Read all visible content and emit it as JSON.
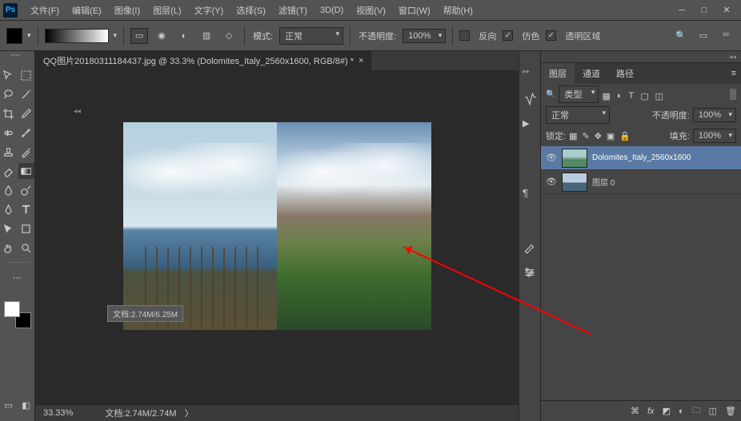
{
  "menu": [
    "文件(F)",
    "编辑(E)",
    "图像(I)",
    "图层(L)",
    "文字(Y)",
    "选择(S)",
    "滤镜(T)",
    "3D(D)",
    "视图(V)",
    "窗口(W)",
    "帮助(H)"
  ],
  "options": {
    "mode_label": "模式:",
    "mode_value": "正常",
    "opacity_label": "不透明度:",
    "opacity_value": "100%",
    "reverse": "反向",
    "dither": "仿色",
    "transparency": "透明区域"
  },
  "doc": {
    "tab_title": "QQ图片20180311184437.jpg @ 33.3% (Dolomites_Italy_2560x1600, RGB/8#) *",
    "zoom": "33.33%",
    "docsize": "文档:2.74M/2.74M",
    "docsize_tip": "文档:2.74M/6.25M"
  },
  "layers_panel": {
    "tabs": [
      "图层",
      "通道",
      "路径"
    ],
    "filter_label": "类型",
    "blend_mode": "正常",
    "opacity_label": "不透明度:",
    "opacity_value": "100%",
    "lock_label": "锁定:",
    "fill_label": "填充:",
    "fill_value": "100%",
    "layers": [
      {
        "name": "Dolomites_Italy_2560x1600",
        "selected": true
      },
      {
        "name": "图层 0",
        "selected": false
      }
    ]
  }
}
